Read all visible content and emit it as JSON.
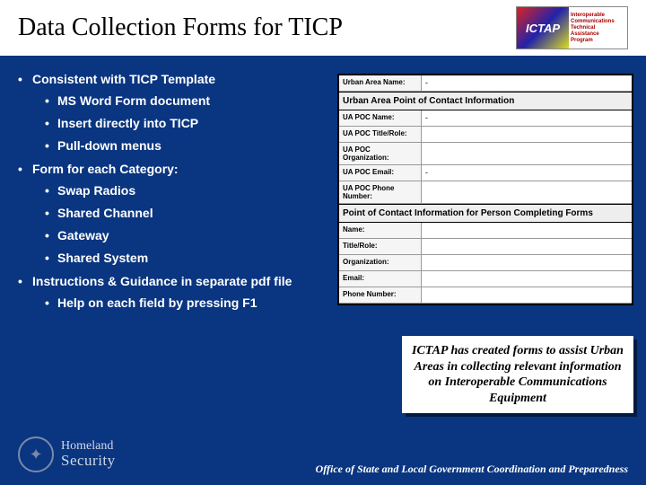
{
  "title": "Data Collection Forms for TICP",
  "logo": {
    "abbr": "ICTAP",
    "tag1": "Interoperable",
    "tag2": "Communications",
    "tag3": "Technical",
    "tag4": "Assistance",
    "tag5": "Program"
  },
  "bullets": {
    "b1": "Consistent with TICP Template",
    "b1_subs": {
      "s1": "MS Word Form document",
      "s2": "Insert directly into TICP",
      "s3": "Pull-down menus"
    },
    "b2": "Form for each Category:",
    "b2_subs": {
      "s1": "Swap Radios",
      "s2": "Shared Channel",
      "s3": "Gateway",
      "s4": "Shared System"
    },
    "b3": "Instructions & Guidance in separate pdf file",
    "b3_subs": {
      "s1": "Help on each field by pressing F1"
    }
  },
  "form": {
    "header_top": {
      "label": "Urban Area Name:",
      "value": "-"
    },
    "section1": "Urban Area Point of Contact Information",
    "rows1": {
      "r1": {
        "label": "UA POC Name:",
        "value": "-"
      },
      "r2": {
        "label": "UA POC Title/Role:",
        "value": ""
      },
      "r3": {
        "label": "UA POC Organization:",
        "value": ""
      },
      "r4": {
        "label": "UA POC Email:",
        "value": "-"
      },
      "r5": {
        "label": "UA POC Phone Number:",
        "value": ""
      }
    },
    "section2": "Point of Contact Information for Person Completing Forms",
    "rows2": {
      "r1": {
        "label": "Name:",
        "value": ""
      },
      "r2": {
        "label": "Title/Role:",
        "value": ""
      },
      "r3": {
        "label": "Organization:",
        "value": ""
      },
      "r4": {
        "label": "Email:",
        "value": ""
      },
      "r5": {
        "label": "Phone Number:",
        "value": ""
      }
    }
  },
  "callout": "ICTAP has created forms to assist Urban Areas in collecting relevant information on Interoperable Communications Equipment",
  "footer": "Office of State and Local Government Coordination and Preparedness",
  "seal": {
    "line1": "Homeland",
    "line2": "Security"
  }
}
